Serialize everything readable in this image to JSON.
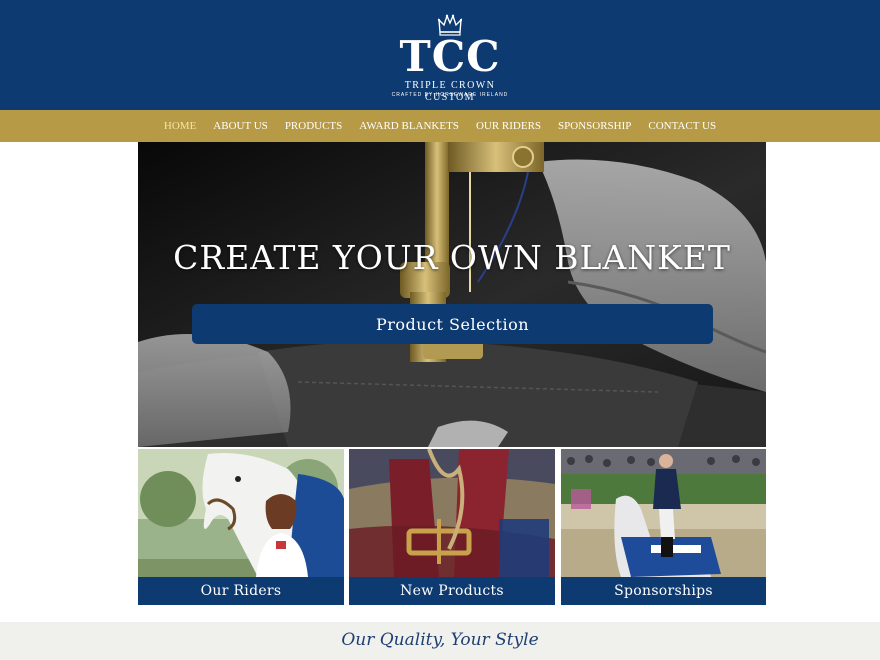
{
  "brand": {
    "logo_text": "TCC",
    "name": "TRIPLE CROWN CUSTOM",
    "tagline_small": "CRAFTED BY HORSEWARE IRELAND",
    "colors": {
      "navy": "#0d3a70",
      "gold": "#b79a45",
      "active_nav": "#f5e3a8"
    }
  },
  "nav": {
    "items": [
      {
        "label": "HOME",
        "active": true
      },
      {
        "label": "ABOUT US",
        "active": false
      },
      {
        "label": "PRODUCTS",
        "active": false
      },
      {
        "label": "AWARD BLANKETS",
        "active": false
      },
      {
        "label": "OUR RIDERS",
        "active": false
      },
      {
        "label": "SPONSORSHIP",
        "active": false
      },
      {
        "label": "CONTACT US",
        "active": false
      }
    ]
  },
  "hero": {
    "title": "CREATE YOUR OWN BLANKET",
    "button_label": "Product Selection"
  },
  "tiles": [
    {
      "label": "Our Riders"
    },
    {
      "label": "New Products"
    },
    {
      "label": "Sponsorships"
    }
  ],
  "footer": {
    "tagline": "Our Quality, Your Style"
  }
}
